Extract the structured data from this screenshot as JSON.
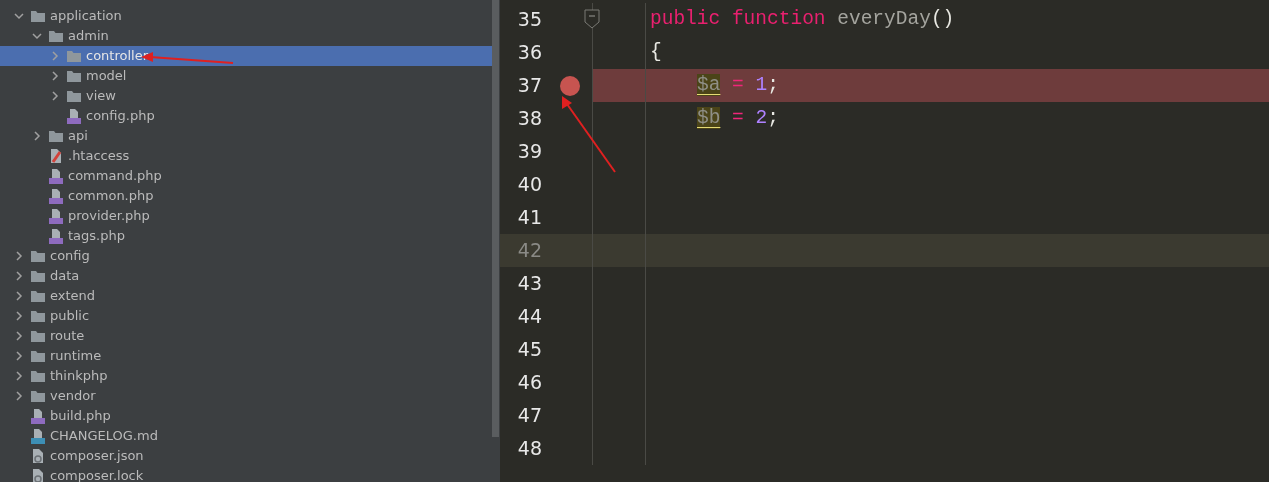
{
  "project_tree": {
    "items": [
      {
        "label": "application",
        "kind": "folder",
        "expanded": true,
        "selected": false,
        "children": [
          {
            "label": "admin",
            "kind": "folder",
            "expanded": true,
            "selected": false,
            "children": [
              {
                "label": "controller",
                "kind": "folder",
                "expanded": false,
                "selected": true
              },
              {
                "label": "model",
                "kind": "folder",
                "expanded": false,
                "selected": false
              },
              {
                "label": "view",
                "kind": "folder",
                "expanded": false,
                "selected": false
              },
              {
                "label": "config.php",
                "kind": "php",
                "selected": false
              }
            ]
          },
          {
            "label": "api",
            "kind": "folder",
            "expanded": false,
            "selected": false
          },
          {
            "label": ".htaccess",
            "kind": "htaccess",
            "selected": false
          },
          {
            "label": "command.php",
            "kind": "php",
            "selected": false
          },
          {
            "label": "common.php",
            "kind": "php",
            "selected": false
          },
          {
            "label": "provider.php",
            "kind": "php",
            "selected": false
          },
          {
            "label": "tags.php",
            "kind": "php",
            "selected": false
          }
        ]
      },
      {
        "label": "config",
        "kind": "folder",
        "expanded": false,
        "selected": false
      },
      {
        "label": "data",
        "kind": "folder",
        "expanded": false,
        "selected": false
      },
      {
        "label": "extend",
        "kind": "folder",
        "expanded": false,
        "selected": false
      },
      {
        "label": "public",
        "kind": "folder",
        "expanded": false,
        "selected": false
      },
      {
        "label": "route",
        "kind": "folder",
        "expanded": false,
        "selected": false
      },
      {
        "label": "runtime",
        "kind": "folder",
        "expanded": false,
        "selected": false
      },
      {
        "label": "thinkphp",
        "kind": "folder",
        "expanded": false,
        "selected": false
      },
      {
        "label": "vendor",
        "kind": "folder",
        "expanded": false,
        "selected": false
      },
      {
        "label": "build.php",
        "kind": "php",
        "selected": false
      },
      {
        "label": "CHANGELOG.md",
        "kind": "md",
        "selected": false
      },
      {
        "label": "composer.json",
        "kind": "json",
        "selected": false
      },
      {
        "label": "composer.lock",
        "kind": "json",
        "selected": false
      }
    ]
  },
  "editor": {
    "lines": [
      {
        "number": "35",
        "breakpoint": false,
        "current": false,
        "fold": true,
        "tokens": [
          {
            "text": "public",
            "kind": "keyword"
          },
          {
            "text": "function",
            "kind": "keyword"
          },
          {
            "text": "everyDay",
            "kind": "name"
          },
          {
            "text": "()",
            "kind": "punct",
            "attached": true
          }
        ]
      },
      {
        "number": "36",
        "breakpoint": false,
        "current": false,
        "tokens": [
          {
            "text": "{",
            "kind": "punct"
          }
        ]
      },
      {
        "number": "37",
        "breakpoint": true,
        "current": false,
        "indented": true,
        "tokens": [
          {
            "text": "$a",
            "kind": "var"
          },
          {
            "text": "=",
            "kind": "op"
          },
          {
            "text": "1",
            "kind": "num"
          },
          {
            "text": ";",
            "kind": "punct",
            "attached": true
          }
        ]
      },
      {
        "number": "38",
        "breakpoint": false,
        "current": false,
        "indented": true,
        "tokens": [
          {
            "text": "$b",
            "kind": "var"
          },
          {
            "text": "=",
            "kind": "op"
          },
          {
            "text": "2",
            "kind": "num"
          },
          {
            "text": ";",
            "kind": "punct",
            "attached": true
          }
        ]
      },
      {
        "number": "39",
        "breakpoint": false,
        "current": false
      },
      {
        "number": "40",
        "breakpoint": false,
        "current": false
      },
      {
        "number": "41",
        "breakpoint": false,
        "current": false
      },
      {
        "number": "42",
        "breakpoint": false,
        "current": true
      },
      {
        "number": "43",
        "breakpoint": false,
        "current": false
      },
      {
        "number": "44",
        "breakpoint": false,
        "current": false
      },
      {
        "number": "45",
        "breakpoint": false,
        "current": false
      },
      {
        "number": "46",
        "breakpoint": false,
        "current": false
      },
      {
        "number": "47",
        "breakpoint": false,
        "current": false
      },
      {
        "number": "48",
        "breakpoint": false,
        "current": false
      }
    ]
  }
}
